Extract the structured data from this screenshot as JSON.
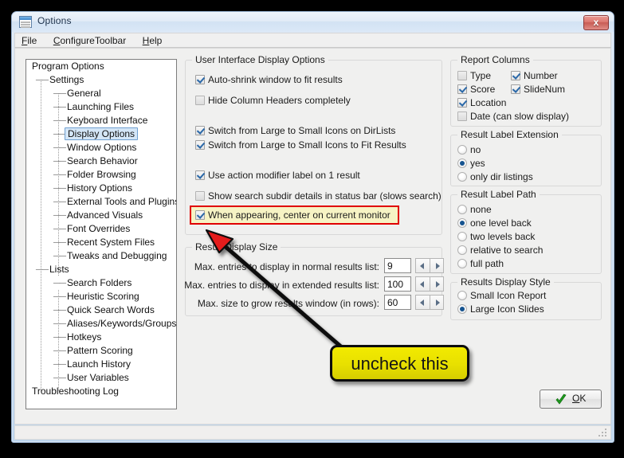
{
  "window": {
    "title": "Options",
    "icon": "options-window-icon",
    "close_label": "x"
  },
  "menubar": {
    "items": [
      {
        "label": "File",
        "accel": "F"
      },
      {
        "label": "ConfigureToolbar",
        "accel": "C"
      },
      {
        "label": "Help",
        "accel": "H"
      }
    ]
  },
  "tree": {
    "nodes": [
      {
        "label": "Program Options",
        "level": 0,
        "selected": false
      },
      {
        "label": "Settings",
        "level": 1,
        "selected": false
      },
      {
        "label": "General",
        "level": 2,
        "selected": false
      },
      {
        "label": "Launching Files",
        "level": 2,
        "selected": false
      },
      {
        "label": "Keyboard Interface",
        "level": 2,
        "selected": false
      },
      {
        "label": "Display Options",
        "level": 2,
        "selected": true
      },
      {
        "label": "Window Options",
        "level": 2,
        "selected": false
      },
      {
        "label": "Search Behavior",
        "level": 2,
        "selected": false
      },
      {
        "label": "Folder Browsing",
        "level": 2,
        "selected": false
      },
      {
        "label": "History Options",
        "level": 2,
        "selected": false
      },
      {
        "label": "External Tools and Plugins",
        "level": 2,
        "selected": false
      },
      {
        "label": "Advanced Visuals",
        "level": 2,
        "selected": false
      },
      {
        "label": "Font Overrides",
        "level": 2,
        "selected": false
      },
      {
        "label": "Recent System Files",
        "level": 2,
        "selected": false
      },
      {
        "label": "Tweaks and Debugging",
        "level": 2,
        "selected": false
      },
      {
        "label": "Lists",
        "level": 1,
        "selected": false
      },
      {
        "label": "Search Folders",
        "level": 2,
        "selected": false
      },
      {
        "label": "Heuristic Scoring",
        "level": 2,
        "selected": false
      },
      {
        "label": "Quick Search Words",
        "level": 2,
        "selected": false
      },
      {
        "label": "Aliases/Keywords/Groups",
        "level": 2,
        "selected": false
      },
      {
        "label": "Hotkeys",
        "level": 2,
        "selected": false
      },
      {
        "label": "Pattern Scoring",
        "level": 2,
        "selected": false
      },
      {
        "label": "Launch History",
        "level": 2,
        "selected": false
      },
      {
        "label": "User Variables",
        "level": 2,
        "selected": false
      },
      {
        "label": "Troubleshooting Log",
        "level": 0,
        "selected": false
      }
    ]
  },
  "ui_display_options": {
    "title": "User Interface Display Options",
    "checkboxes": [
      {
        "label": "Auto-shrink window to fit results",
        "checked": true,
        "highlighted": false
      },
      {
        "label": "Hide Column Headers completely",
        "checked": false,
        "highlighted": false
      },
      {
        "label": "Switch from Large to Small Icons on DirLists",
        "checked": true,
        "highlighted": false
      },
      {
        "label": "Switch from Large to Small Icons to Fit Results",
        "checked": true,
        "highlighted": false
      },
      {
        "label": "Use action modifier label on 1 result",
        "checked": true,
        "highlighted": false
      },
      {
        "label": "Show search subdir details in status bar (slows search)",
        "checked": false,
        "highlighted": false
      },
      {
        "label": "When appearing, center on current monitor",
        "checked": true,
        "highlighted": true
      }
    ]
  },
  "result_display_size": {
    "title": "Result Display Size",
    "rows": [
      {
        "label": "Max. entries to display in normal results list:",
        "value": "9"
      },
      {
        "label": "Max. entries to display in extended results list:",
        "value": "100"
      },
      {
        "label": "Max. size to grow results window (in rows):",
        "value": "60"
      }
    ]
  },
  "report_columns": {
    "title": "Report Columns",
    "checkboxes": [
      {
        "label": "Type",
        "checked": false
      },
      {
        "label": "Number",
        "checked": true
      },
      {
        "label": "Score",
        "checked": true
      },
      {
        "label": "SlideNum",
        "checked": true
      },
      {
        "label": "Location",
        "checked": true
      },
      {
        "label": "Date (can slow display)",
        "checked": false
      }
    ]
  },
  "result_label_extension": {
    "title": "Result Label Extension",
    "options": [
      {
        "label": "no",
        "selected": false
      },
      {
        "label": "yes",
        "selected": true
      },
      {
        "label": "only dir listings",
        "selected": false
      }
    ]
  },
  "result_label_path": {
    "title": "Result Label Path",
    "options": [
      {
        "label": "none",
        "selected": false
      },
      {
        "label": "one level back",
        "selected": true
      },
      {
        "label": "two levels back",
        "selected": false
      },
      {
        "label": "relative to search",
        "selected": false
      },
      {
        "label": "full path",
        "selected": false
      }
    ]
  },
  "results_display_style": {
    "title": "Results Display Style",
    "options": [
      {
        "label": "Small Icon Report",
        "selected": false
      },
      {
        "label": "Large Icon Slides",
        "selected": true
      }
    ]
  },
  "ok_button": {
    "label": "OK",
    "accel": "O",
    "icon": "green-check-icon"
  },
  "annotation": {
    "callout_text": "uncheck this",
    "arrow": "red-arrowhead-pointing-to-highlighted-checkbox"
  },
  "colors": {
    "highlight_fill": "#f6f3c4",
    "highlight_border": "#e00000",
    "callout_fill": "#e8e000",
    "callout_border": "#0d0d0d",
    "accent_blue": "#15538f",
    "ok_check": "#22aa22"
  }
}
